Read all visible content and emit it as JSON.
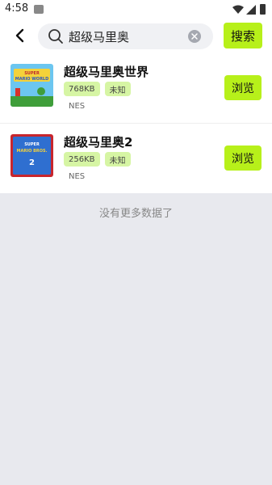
{
  "status_bar": {
    "time": "4:58"
  },
  "search": {
    "query": "超级马里奥",
    "button_label": "搜索"
  },
  "results": [
    {
      "title": "超级马里奥世界",
      "size": "768KB",
      "status": "未知",
      "platform": "NES",
      "action_label": "浏览",
      "thumb_text": "SUPER MARIO WORLD"
    },
    {
      "title": "超级马里奥2",
      "size": "256KB",
      "status": "未知",
      "platform": "NES",
      "action_label": "浏览",
      "thumb_text": "SUPER MARIO BROS. 2"
    }
  ],
  "footer": {
    "no_more_text": "没有更多数据了"
  },
  "colors": {
    "accent": "#b7f01a",
    "tag_bg": "#d6f5a4",
    "background": "#e8e9ee"
  }
}
